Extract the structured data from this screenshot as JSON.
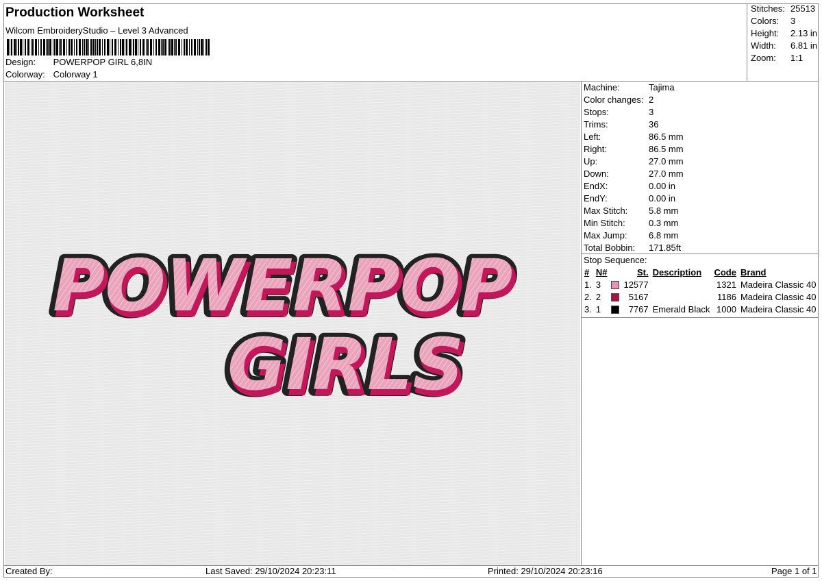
{
  "header": {
    "title": "Production Worksheet",
    "subtitle": "Wilcom EmbroideryStudio – Level 3 Advanced",
    "design_label": "Design:",
    "design_value": "POWERPOP GIRL 6,8IN",
    "colorway_label": "Colorway:",
    "colorway_value": "Colorway 1"
  },
  "summary": [
    {
      "label": "Stitches:",
      "value": "25513"
    },
    {
      "label": "Colors:",
      "value": "3"
    },
    {
      "label": "Height:",
      "value": "2.13 in"
    },
    {
      "label": "Width:",
      "value": "6.81 in"
    },
    {
      "label": "Zoom:",
      "value": "1:1"
    }
  ],
  "machine_info": [
    {
      "label": "Machine:",
      "value": "Tajima"
    },
    {
      "label": "Color changes:",
      "value": "2"
    },
    {
      "label": "Stops:",
      "value": "3"
    },
    {
      "label": "Trims:",
      "value": "36"
    },
    {
      "label": "Left:",
      "value": "86.5 mm"
    },
    {
      "label": "Right:",
      "value": "86.5 mm"
    },
    {
      "label": "Up:",
      "value": "27.0 mm"
    },
    {
      "label": "Down:",
      "value": "27.0 mm"
    },
    {
      "label": "EndX:",
      "value": "0.00 in"
    },
    {
      "label": "EndY:",
      "value": "0.00 in"
    },
    {
      "label": "Max Stitch:",
      "value": "5.8 mm"
    },
    {
      "label": "Min Stitch:",
      "value": "0.3 mm"
    },
    {
      "label": "Max Jump:",
      "value": "6.8 mm"
    },
    {
      "label": "Total Bobbin:",
      "value": "171.85ft"
    }
  ],
  "stop_sequence": {
    "title": "Stop Sequence:",
    "headers": {
      "num": "#",
      "n": "N#",
      "st": "St.",
      "desc": "Description",
      "code": "Code",
      "brand": "Brand"
    },
    "rows": [
      {
        "num": "1.",
        "n": "3",
        "color": "#e891b0",
        "st": "12577",
        "desc": "",
        "code": "1321",
        "brand": "Madeira Classic 40"
      },
      {
        "num": "2.",
        "n": "2",
        "color": "#b0103f",
        "st": "5167",
        "desc": "",
        "code": "1186",
        "brand": "Madeira Classic 40"
      },
      {
        "num": "3.",
        "n": "1",
        "color": "#000000",
        "st": "7767",
        "desc": "Emerald Black",
        "code": "1000",
        "brand": "Madeira Classic 40"
      }
    ]
  },
  "design_preview": {
    "line1": "POWERPOP",
    "line2": "GIRLS",
    "fill_color": "#e9a3bb",
    "shadow_color": "#c2185b",
    "outline_color": "#222222"
  },
  "footer": {
    "created_by": "Created By:",
    "last_saved": "Last Saved: 29/10/2024 20:23:11",
    "printed": "Printed: 29/10/2024 20:23:16",
    "page": "Page 1 of 1"
  }
}
